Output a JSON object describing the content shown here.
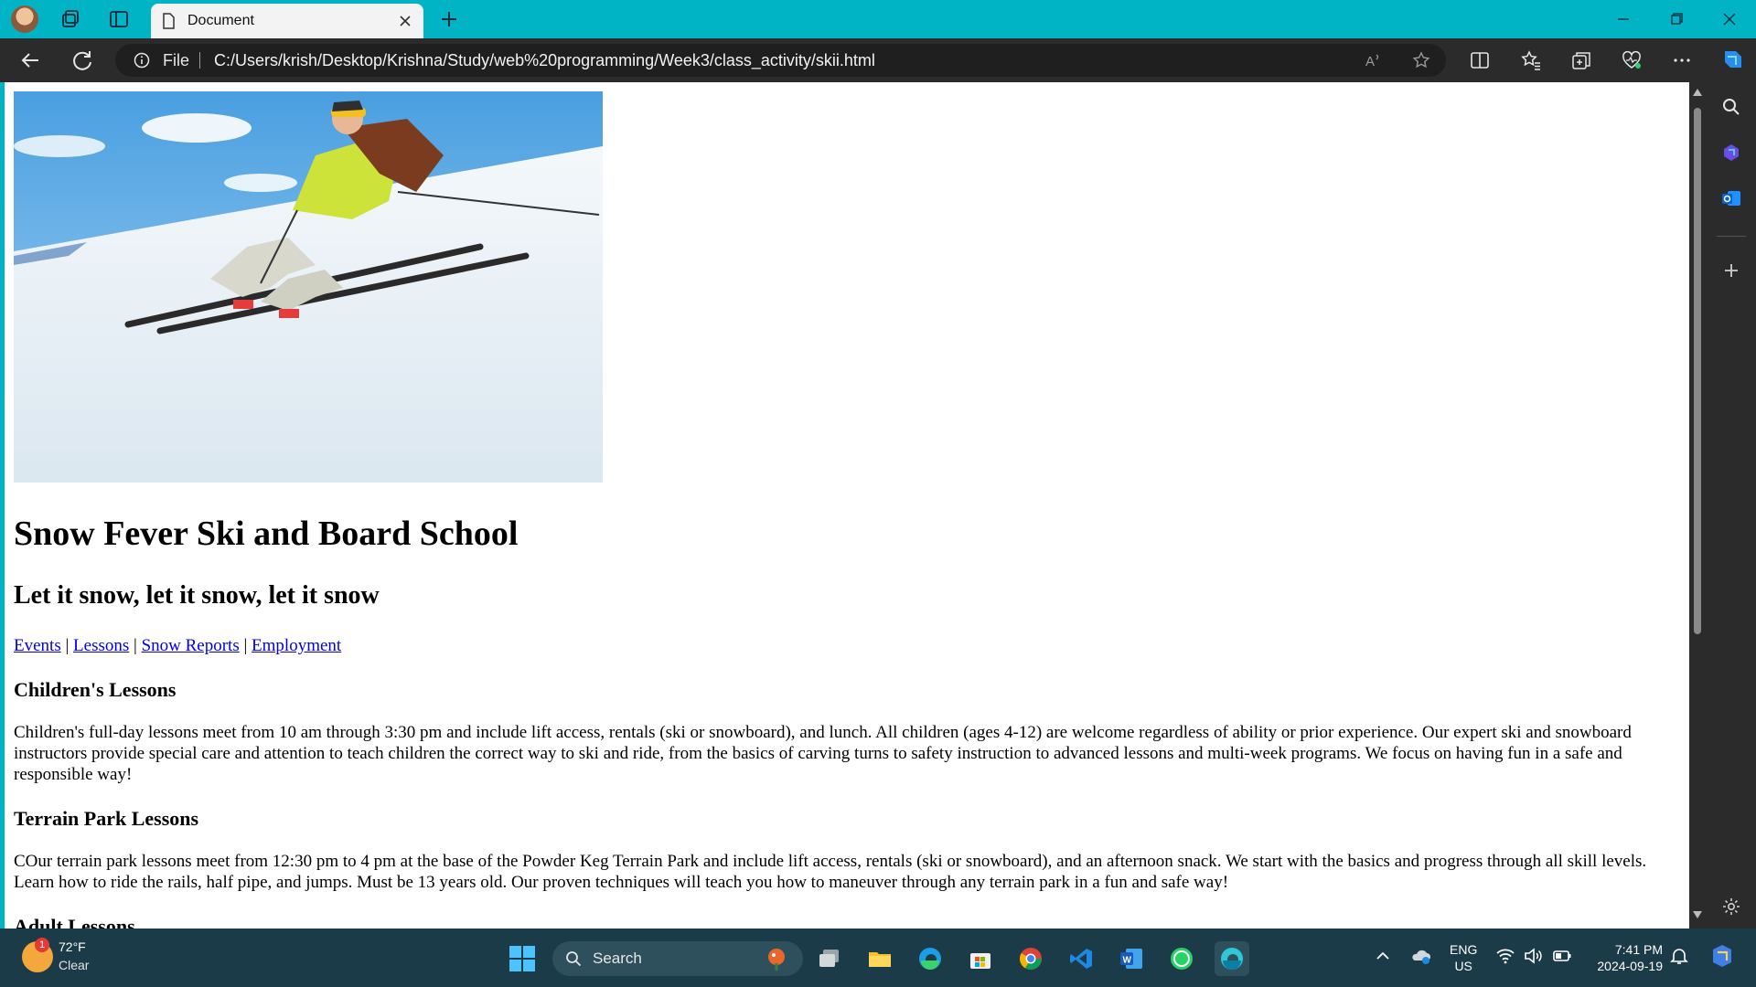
{
  "browser": {
    "tab_title": "Document",
    "url_scheme_label": "File",
    "url": "C:/Users/krish/Desktop/Krishna/Study/web%20programming/Week3/class_activity/skii.html"
  },
  "page": {
    "hero_alt": "",
    "title": "Snow Fever Ski and Board School",
    "subtitle": "Let it snow, let it snow, let it snow",
    "nav": [
      {
        "label": "Events"
      },
      {
        "label": "Lessons"
      },
      {
        "label": "Snow Reports"
      },
      {
        "label": "Employment"
      }
    ],
    "sections": [
      {
        "heading": "Children's Lessons",
        "body": "Children's full-day lessons meet from 10 am through 3:30 pm and include lift access, rentals (ski or snowboard), and lunch. All children (ages 4-12) are welcome regardless of ability or prior experience. Our expert ski and snowboard instructors provide special care and attention to teach children the correct way to ski and ride, from the basics of carving turns to safety instruction to advanced lessons and multi-week programs. We focus on having fun in a safe and responsible way!"
      },
      {
        "heading": "Terrain Park Lessons",
        "body": "COur terrain park lessons meet from 12:30 pm to 4 pm at the base of the Powder Keg Terrain Park and include lift access, rentals (ski or snowboard), and an afternoon snack. We start with the basics and progress through all skill levels. Learn how to ride the rails, half pipe, and jumps. Must be 13 years old. Our proven techniques will teach you how to maneuver through any terrain park in a fun and safe way!"
      },
      {
        "heading": "Adult Lessons"
      }
    ]
  },
  "taskbar": {
    "weather_badge": "1",
    "temperature": "72°F",
    "condition": "Clear",
    "search_label": "Search",
    "lang_primary": "ENG",
    "lang_secondary": "US",
    "time": "7:41 PM",
    "date": "2024-09-19"
  },
  "colors": {
    "tabbar": "#00b4c6",
    "toolbar": "#2b2b2b",
    "taskbar": "#1c3b49",
    "link": "#0000ee"
  }
}
